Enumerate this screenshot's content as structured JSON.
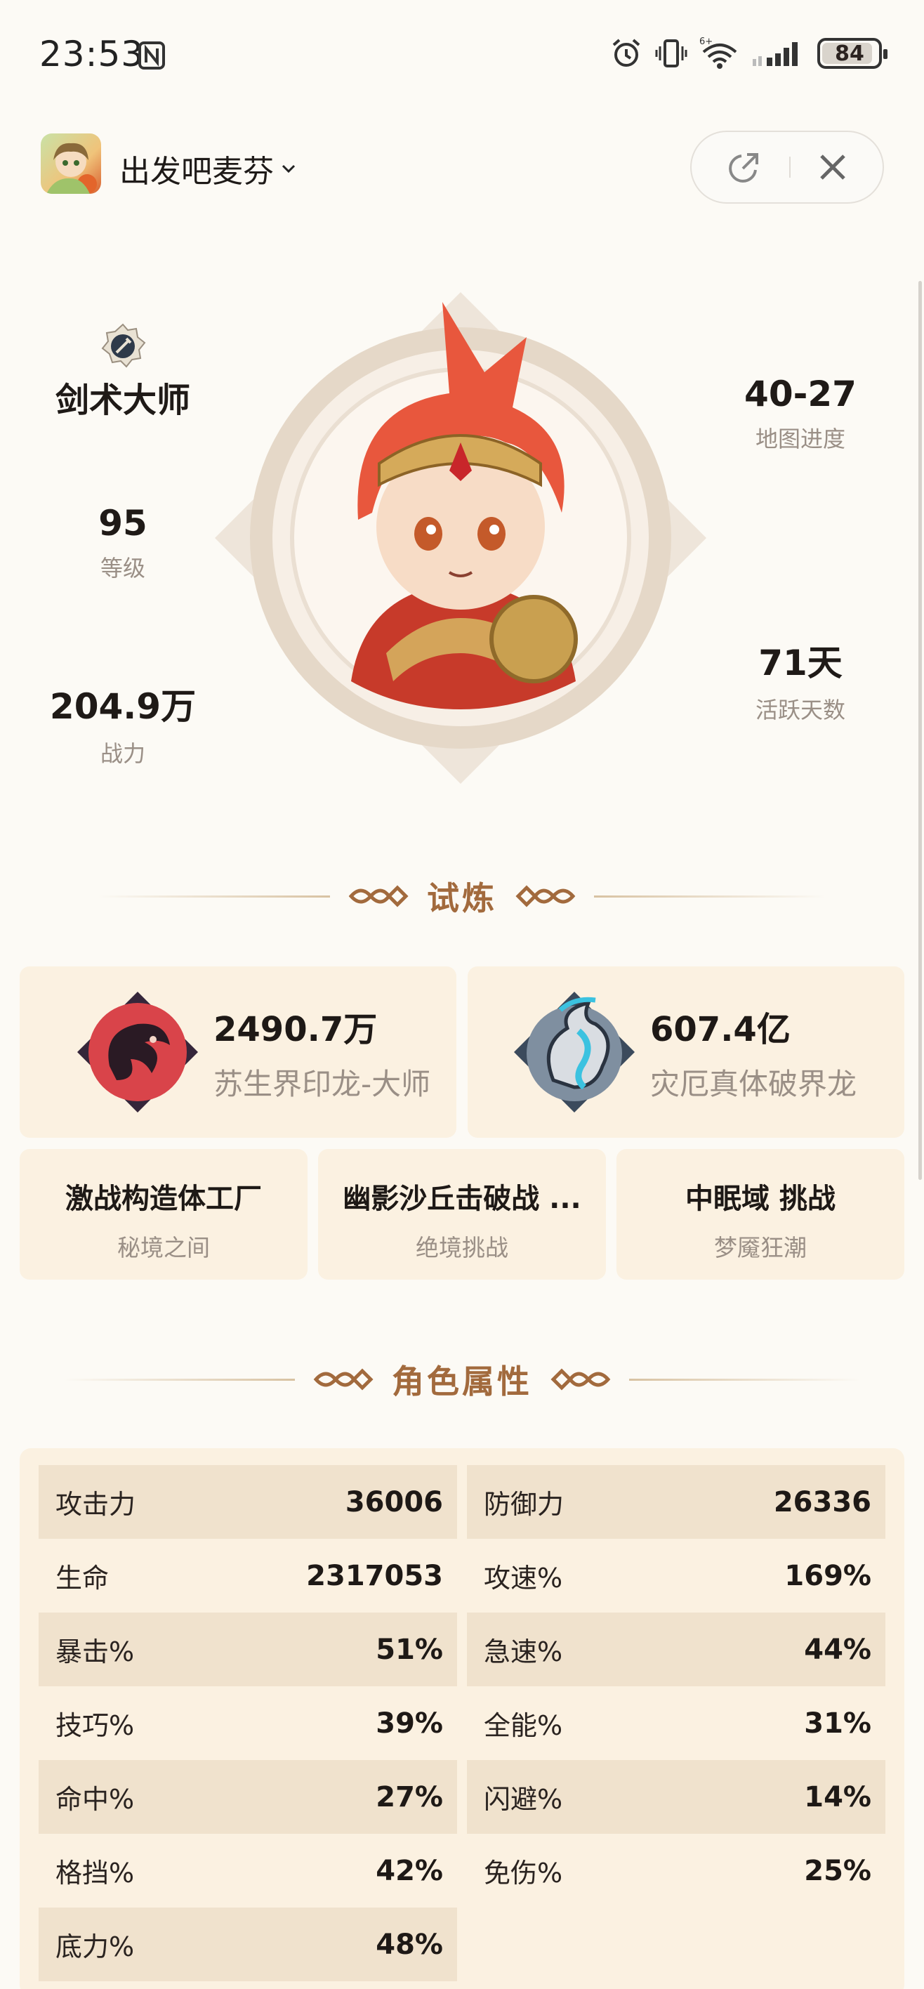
{
  "status_bar": {
    "time": "23:53",
    "battery_level": "84",
    "icons": [
      "nfc-icon",
      "alarm-icon",
      "vibrate-icon",
      "wifi-6-icon",
      "signal-icon",
      "battery-icon"
    ]
  },
  "header": {
    "app_name": "出发吧麦芬",
    "icons": [
      "chevron-down-icon",
      "share-icon",
      "close-icon"
    ]
  },
  "profile": {
    "title": "剑术大师",
    "level_value": "95",
    "level_label": "等级",
    "power_value": "204.9万",
    "power_label": "战力",
    "map_value": "40-27",
    "map_label": "地图进度",
    "active_value": "71天",
    "active_label": "活跃天数"
  },
  "trials": {
    "section_title": "试炼",
    "big_cards": [
      {
        "value": "2490.7万",
        "name": "苏生界印龙-大师"
      },
      {
        "value": "607.4亿",
        "name": "灾厄真体破界龙"
      }
    ],
    "small_cards": [
      {
        "title": "激战构造体工厂",
        "subtitle": "秘境之间"
      },
      {
        "title": "幽影沙丘击破战 ...",
        "subtitle": "绝境挑战"
      },
      {
        "title": "中眠域 挑战",
        "subtitle": "梦魇狂潮"
      }
    ]
  },
  "attributes": {
    "section_title": "角色属性",
    "left": [
      {
        "name": "攻击力",
        "value": "36006"
      },
      {
        "name": "生命",
        "value": "2317053"
      },
      {
        "name": "暴击%",
        "value": "51%"
      },
      {
        "name": "技巧%",
        "value": "39%"
      },
      {
        "name": "命中%",
        "value": "27%"
      },
      {
        "name": "格挡%",
        "value": "42%"
      },
      {
        "name": "底力%",
        "value": "48%"
      }
    ],
    "right": [
      {
        "name": "防御力",
        "value": "26336"
      },
      {
        "name": "攻速%",
        "value": "169%"
      },
      {
        "name": "急速%",
        "value": "44%"
      },
      {
        "name": "全能%",
        "value": "31%"
      },
      {
        "name": "闪避%",
        "value": "14%"
      },
      {
        "name": "免伤%",
        "value": "25%"
      }
    ]
  },
  "colors": {
    "background": "#fcfaf5",
    "card": "#fbf1e1",
    "row_shade": "#f0e2cd",
    "accent": "#a26a3d",
    "muted_text": "#9a8f86"
  }
}
